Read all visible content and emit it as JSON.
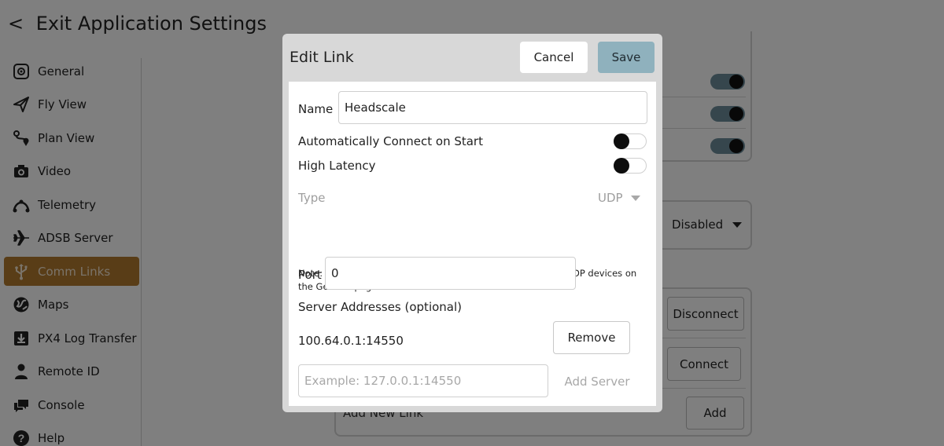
{
  "header": {
    "back_glyph": "<",
    "title": "Exit Application Settings"
  },
  "sidebar": {
    "items": [
      {
        "label": "General",
        "icon": "general-icon"
      },
      {
        "label": "Fly View",
        "icon": "paper-plane-icon"
      },
      {
        "label": "Plan View",
        "icon": "route-icon"
      },
      {
        "label": "Video",
        "icon": "camera-icon"
      },
      {
        "label": "Telemetry",
        "icon": "telemetry-icon"
      },
      {
        "label": "ADSB Server",
        "icon": "airplane-icon"
      },
      {
        "label": "Comm Links",
        "icon": "usb-icon",
        "active": true
      },
      {
        "label": "Maps",
        "icon": "globe-icon"
      },
      {
        "label": "PX4 Log Transfer",
        "icon": "download-icon"
      },
      {
        "label": "Remote ID",
        "icon": "person-icon"
      },
      {
        "label": "Console",
        "icon": "chat-icon"
      },
      {
        "label": "Help",
        "icon": "help-icon"
      }
    ]
  },
  "background": {
    "select_value": "Disabled",
    "disconnect_label": "Disconnect",
    "connect_label": "Connect",
    "add_new_link_label": "Add New Link",
    "add_label": "Add"
  },
  "dialog": {
    "title": "Edit Link",
    "cancel_label": "Cancel",
    "save_label": "Save",
    "name_label": "Name",
    "name_value": "Headscale",
    "auto_connect_label": "Automatically Connect on Start",
    "auto_connect_on": false,
    "high_latency_label": "High Latency",
    "high_latency_on": false,
    "type_label": "Type",
    "type_value": "UDP",
    "note": "Note: For best perfomance, please disable AutoConnect to UDP devices on the General page.",
    "port_label": "Port",
    "port_value": "0",
    "server_addresses_label": "Server Addresses (optional)",
    "server_address": "100.64.0.1:14550",
    "remove_label": "Remove",
    "new_server_placeholder": "Example: 127.0.0.1:14550",
    "add_server_label": "Add Server"
  },
  "colors": {
    "active_sidebar": "#b37a2e",
    "save_button": "#8fb1bd",
    "toggle_on": "#6c8d9b"
  }
}
